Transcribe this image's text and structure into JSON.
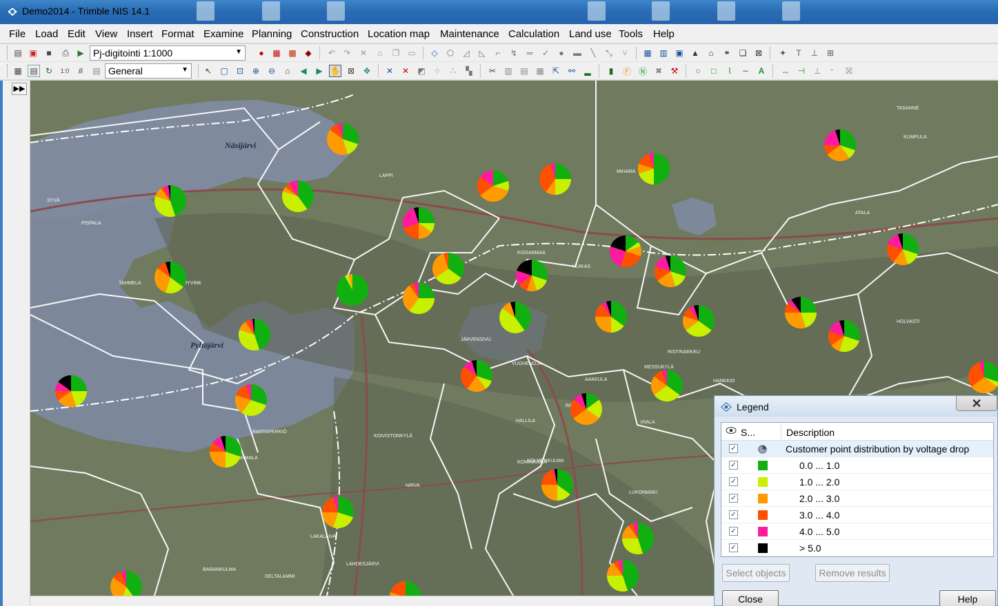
{
  "window": {
    "title": "Demo2014 - Trimble NIS 14.1"
  },
  "menu": [
    "File",
    "Load",
    "Edit",
    "View",
    "Insert",
    "Format",
    "Examine",
    "Planning",
    "Construction",
    "Location map",
    "Maintenance",
    "Calculation",
    "Land use",
    "Tools",
    "Help"
  ],
  "toolbar": {
    "view_combo": "Pj-digitointi 1:1000",
    "style_combo": "General"
  },
  "map": {
    "place_labels": [
      "Näsijärvi",
      "Pyhäjärvi",
      "TAHMELA",
      "HYVINK",
      "SYVÄ",
      "PISPALA",
      "LAPPI",
      "KISSANMAA",
      "HUIKAS",
      "JÄRVENSIVU",
      "VUOHENOJA",
      "AAKKULA",
      "MESSUKYLÄ",
      "RISTINARKKU",
      "HARMALA",
      "RANTAPERKIÖ",
      "KOIVISTONKYLÄ",
      "NIRVA",
      "LAKALAIVA",
      "LAHDESJÄRVI",
      "DELTALAMMI",
      "BARANKULMA",
      "LUKONMÄKI",
      "VIIALA",
      "HALLILA",
      "RAHOLA",
      "KOLMENKULMA",
      "HANKKIO",
      "TASANNE",
      "KUMPULA",
      "ATALA",
      "HOLVASTI",
      "MIHARA",
      "KOMINKAMA"
    ],
    "pie_colors": [
      "#10b010",
      "#c8f000",
      "#ff9a00",
      "#ff5000",
      "#ff1aa0",
      "#000000"
    ]
  },
  "legend": {
    "title": "Legend",
    "col_show": "S...",
    "col_description": "Description",
    "rows": [
      {
        "label": "Customer point distribution by voltage drop",
        "color": "",
        "checked": true
      },
      {
        "label": "0.0 ... 1.0",
        "color": "#10b010",
        "checked": true
      },
      {
        "label": "1.0 ... 2.0",
        "color": "#c8f000",
        "checked": true
      },
      {
        "label": "2.0 ... 3.0",
        "color": "#ff9a00",
        "checked": true
      },
      {
        "label": "3.0 ... 4.0",
        "color": "#ff5000",
        "checked": true
      },
      {
        "label": "4.0 ... 5.0",
        "color": "#ff1aa0",
        "checked": true
      },
      {
        "label": "> 5.0",
        "color": "#000000",
        "checked": true
      }
    ],
    "buttons": {
      "select": "Select objects",
      "remove": "Remove results",
      "close": "Close",
      "help": "Help"
    }
  }
}
